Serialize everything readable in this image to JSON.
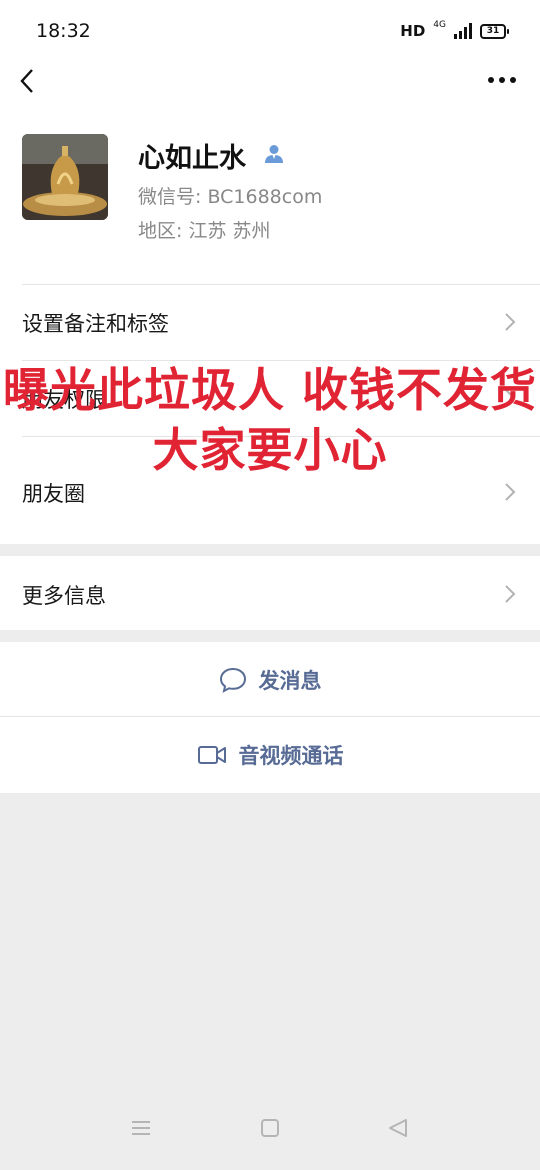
{
  "status_bar": {
    "time": "18:32",
    "hd": "HD",
    "network": "4G",
    "battery": "31"
  },
  "nav": {
    "back_icon": "chevron-left-icon",
    "more_icon": "more-dots-icon"
  },
  "profile": {
    "name": "心如止水",
    "wechat_id": "微信号: BC1688com",
    "region": "地区: 江苏  苏州",
    "badge_icon": "person-icon"
  },
  "menu": {
    "remark_tags": "设置备注和标签",
    "friend_permission": "朋友权限",
    "moments": "朋友圈",
    "more_info": "更多信息"
  },
  "actions": {
    "send_message": "发消息",
    "video_call": "音视频通话"
  },
  "overlay": {
    "line1": "曝光此垃圾人 收钱不发货",
    "line2": "大家要小心"
  },
  "colors": {
    "link_blue": "#576b95",
    "warning_red": "#e02434",
    "background": "#ededed"
  }
}
